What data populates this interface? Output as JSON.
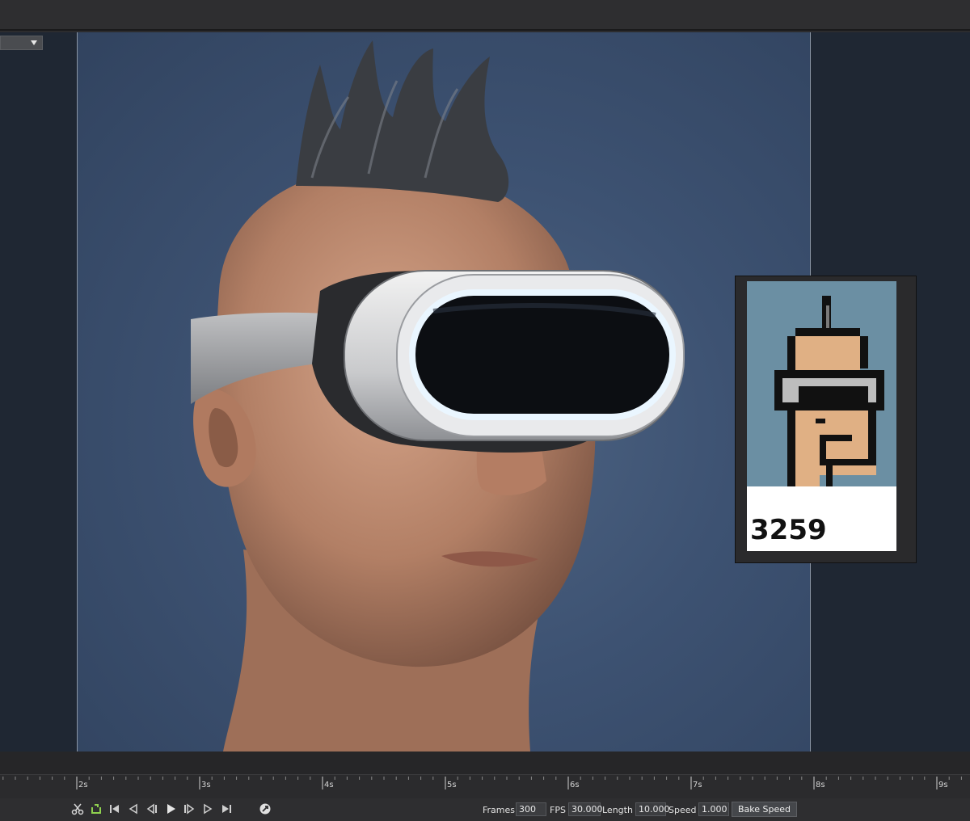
{
  "nft": {
    "number": "3259"
  },
  "timeline": {
    "ticks": [
      "2s",
      "3s",
      "4s",
      "5s",
      "6s",
      "7s",
      "8s",
      "9s"
    ]
  },
  "controls": {
    "frames_label": "Frames",
    "frames_value": "300",
    "fps_label": "FPS",
    "fps_value": "30.000",
    "length_label": "Length",
    "length_value": "10.000",
    "speed_label": "Speed",
    "speed_value": "1.000",
    "bake_speed_label": "Bake Speed"
  },
  "colors": {
    "viewport_bg": "#1f2733",
    "render_bg": "#3d5272",
    "loop_icon_accent": "#8fd14f",
    "nft_bg": "#6b8fa3"
  },
  "icons": [
    "scissors-icon",
    "loop-icon",
    "skip-to-start-icon",
    "step-back-icon",
    "prev-frame-icon",
    "play-icon",
    "next-frame-icon",
    "step-forward-icon",
    "skip-to-end-icon",
    "render-settings-icon"
  ]
}
